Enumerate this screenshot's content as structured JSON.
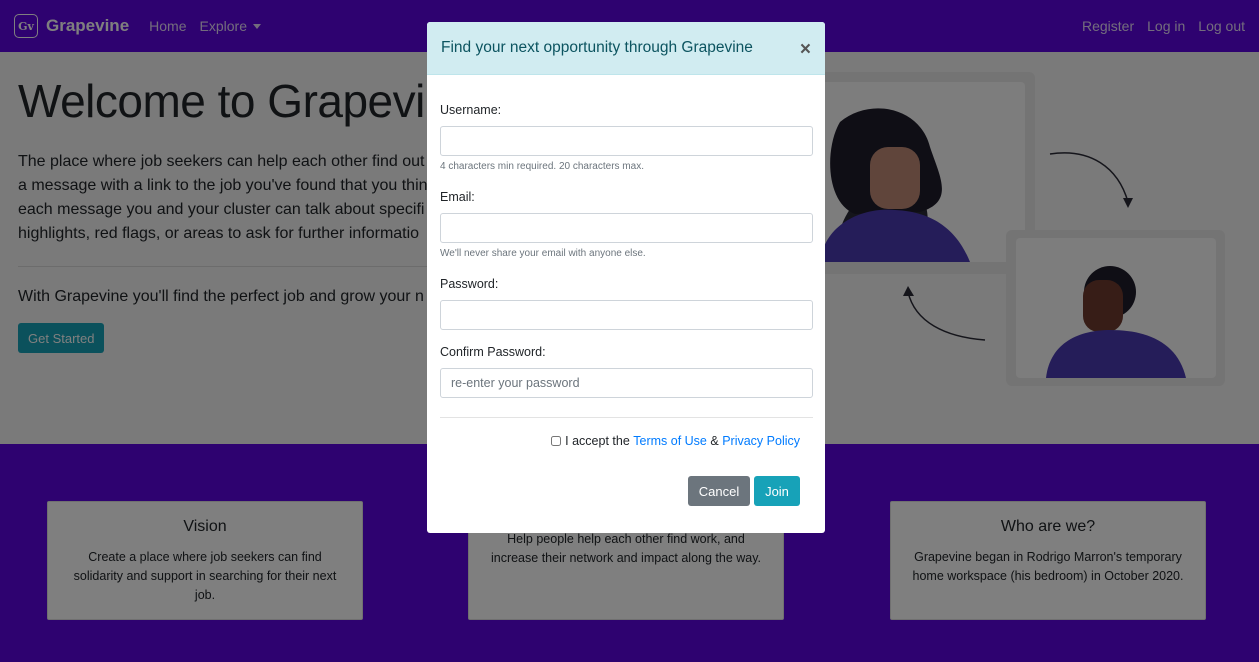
{
  "navbar": {
    "brand_logo": "Gv",
    "brand": "Grapevine",
    "home": "Home",
    "explore": "Explore",
    "register": "Register",
    "login": "Log in",
    "logout": "Log out",
    "color": "#5d04e0"
  },
  "hero": {
    "title": "Welcome to Grapevine",
    "lead_lines": [
      "The place where job seekers can help each other find out",
      "a message with a link to the job you've found that you thin",
      "each message you and your cluster can talk about specifi",
      "highlights, red flags, or areas to ask for further informatio"
    ],
    "tagline": "With Grapevine you'll find the perfect job and grow your n",
    "cta": "Get Started"
  },
  "cards": [
    {
      "title": "Vision",
      "text": "Create a place where job seekers can find solidarity and support in searching for their next job."
    },
    {
      "title": "",
      "text": "Help people help each other find work, and increase their network and impact along the way."
    },
    {
      "title": "Who are we?",
      "text": "Grapevine began in Rodrigo Marron's temporary home workspace (his bedroom) in October 2020."
    }
  ],
  "modal": {
    "title": "Find your next opportunity through Grapevine",
    "close": "×",
    "username_label": "Username:",
    "username_value": "",
    "username_help": "4 characters min required. 20 characters max.",
    "email_label": "Email:",
    "email_value": "",
    "email_help": "We'll never share your email with anyone else.",
    "password_label": "Password:",
    "password_value": "",
    "confirm_label": "Confirm Password:",
    "confirm_placeholder": "re-enter your password",
    "accept_prefix": "I accept the",
    "terms_link": "Terms of Use",
    "amp": "&",
    "privacy_link": "Privacy Policy",
    "cancel": "Cancel",
    "join": "Join"
  }
}
